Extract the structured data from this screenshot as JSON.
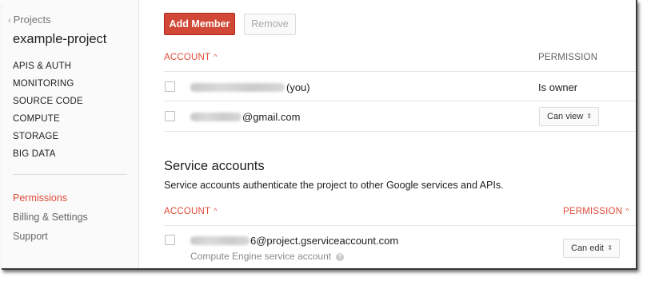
{
  "sidebar": {
    "back_label": "Projects",
    "back_icon": "chevron-left-icon",
    "project_name": "example-project",
    "nav_upper": [
      "APIS & AUTH",
      "MONITORING",
      "SOURCE CODE",
      "COMPUTE",
      "STORAGE",
      "BIG DATA"
    ],
    "nav_lower": [
      {
        "label": "Permissions",
        "active": true
      },
      {
        "label": "Billing & Settings",
        "active": false
      },
      {
        "label": "Support",
        "active": false
      }
    ]
  },
  "toolbar": {
    "add_label": "Add Member",
    "remove_label": "Remove"
  },
  "members": {
    "account_header": "ACCOUNT",
    "permission_header": "PERMISSION",
    "rows": [
      {
        "account_suffix": "(you)",
        "permission": "Is owner",
        "editable": false
      },
      {
        "account_suffix": "@gmail.com",
        "permission": "Can view",
        "editable": true
      }
    ]
  },
  "service_accounts": {
    "title": "Service accounts",
    "description": "Service accounts authenticate the project to other Google services and APIs.",
    "account_header": "ACCOUNT",
    "permission_header": "PERMISSION",
    "rows": [
      {
        "account_suffix": "6@project.gserviceaccount.com",
        "subtitle": "Compute Engine service account",
        "help_glyph": "?",
        "permission": "Can edit"
      }
    ]
  },
  "colors": {
    "accent_red": "#dd4b39",
    "button_red": "#d14836"
  }
}
